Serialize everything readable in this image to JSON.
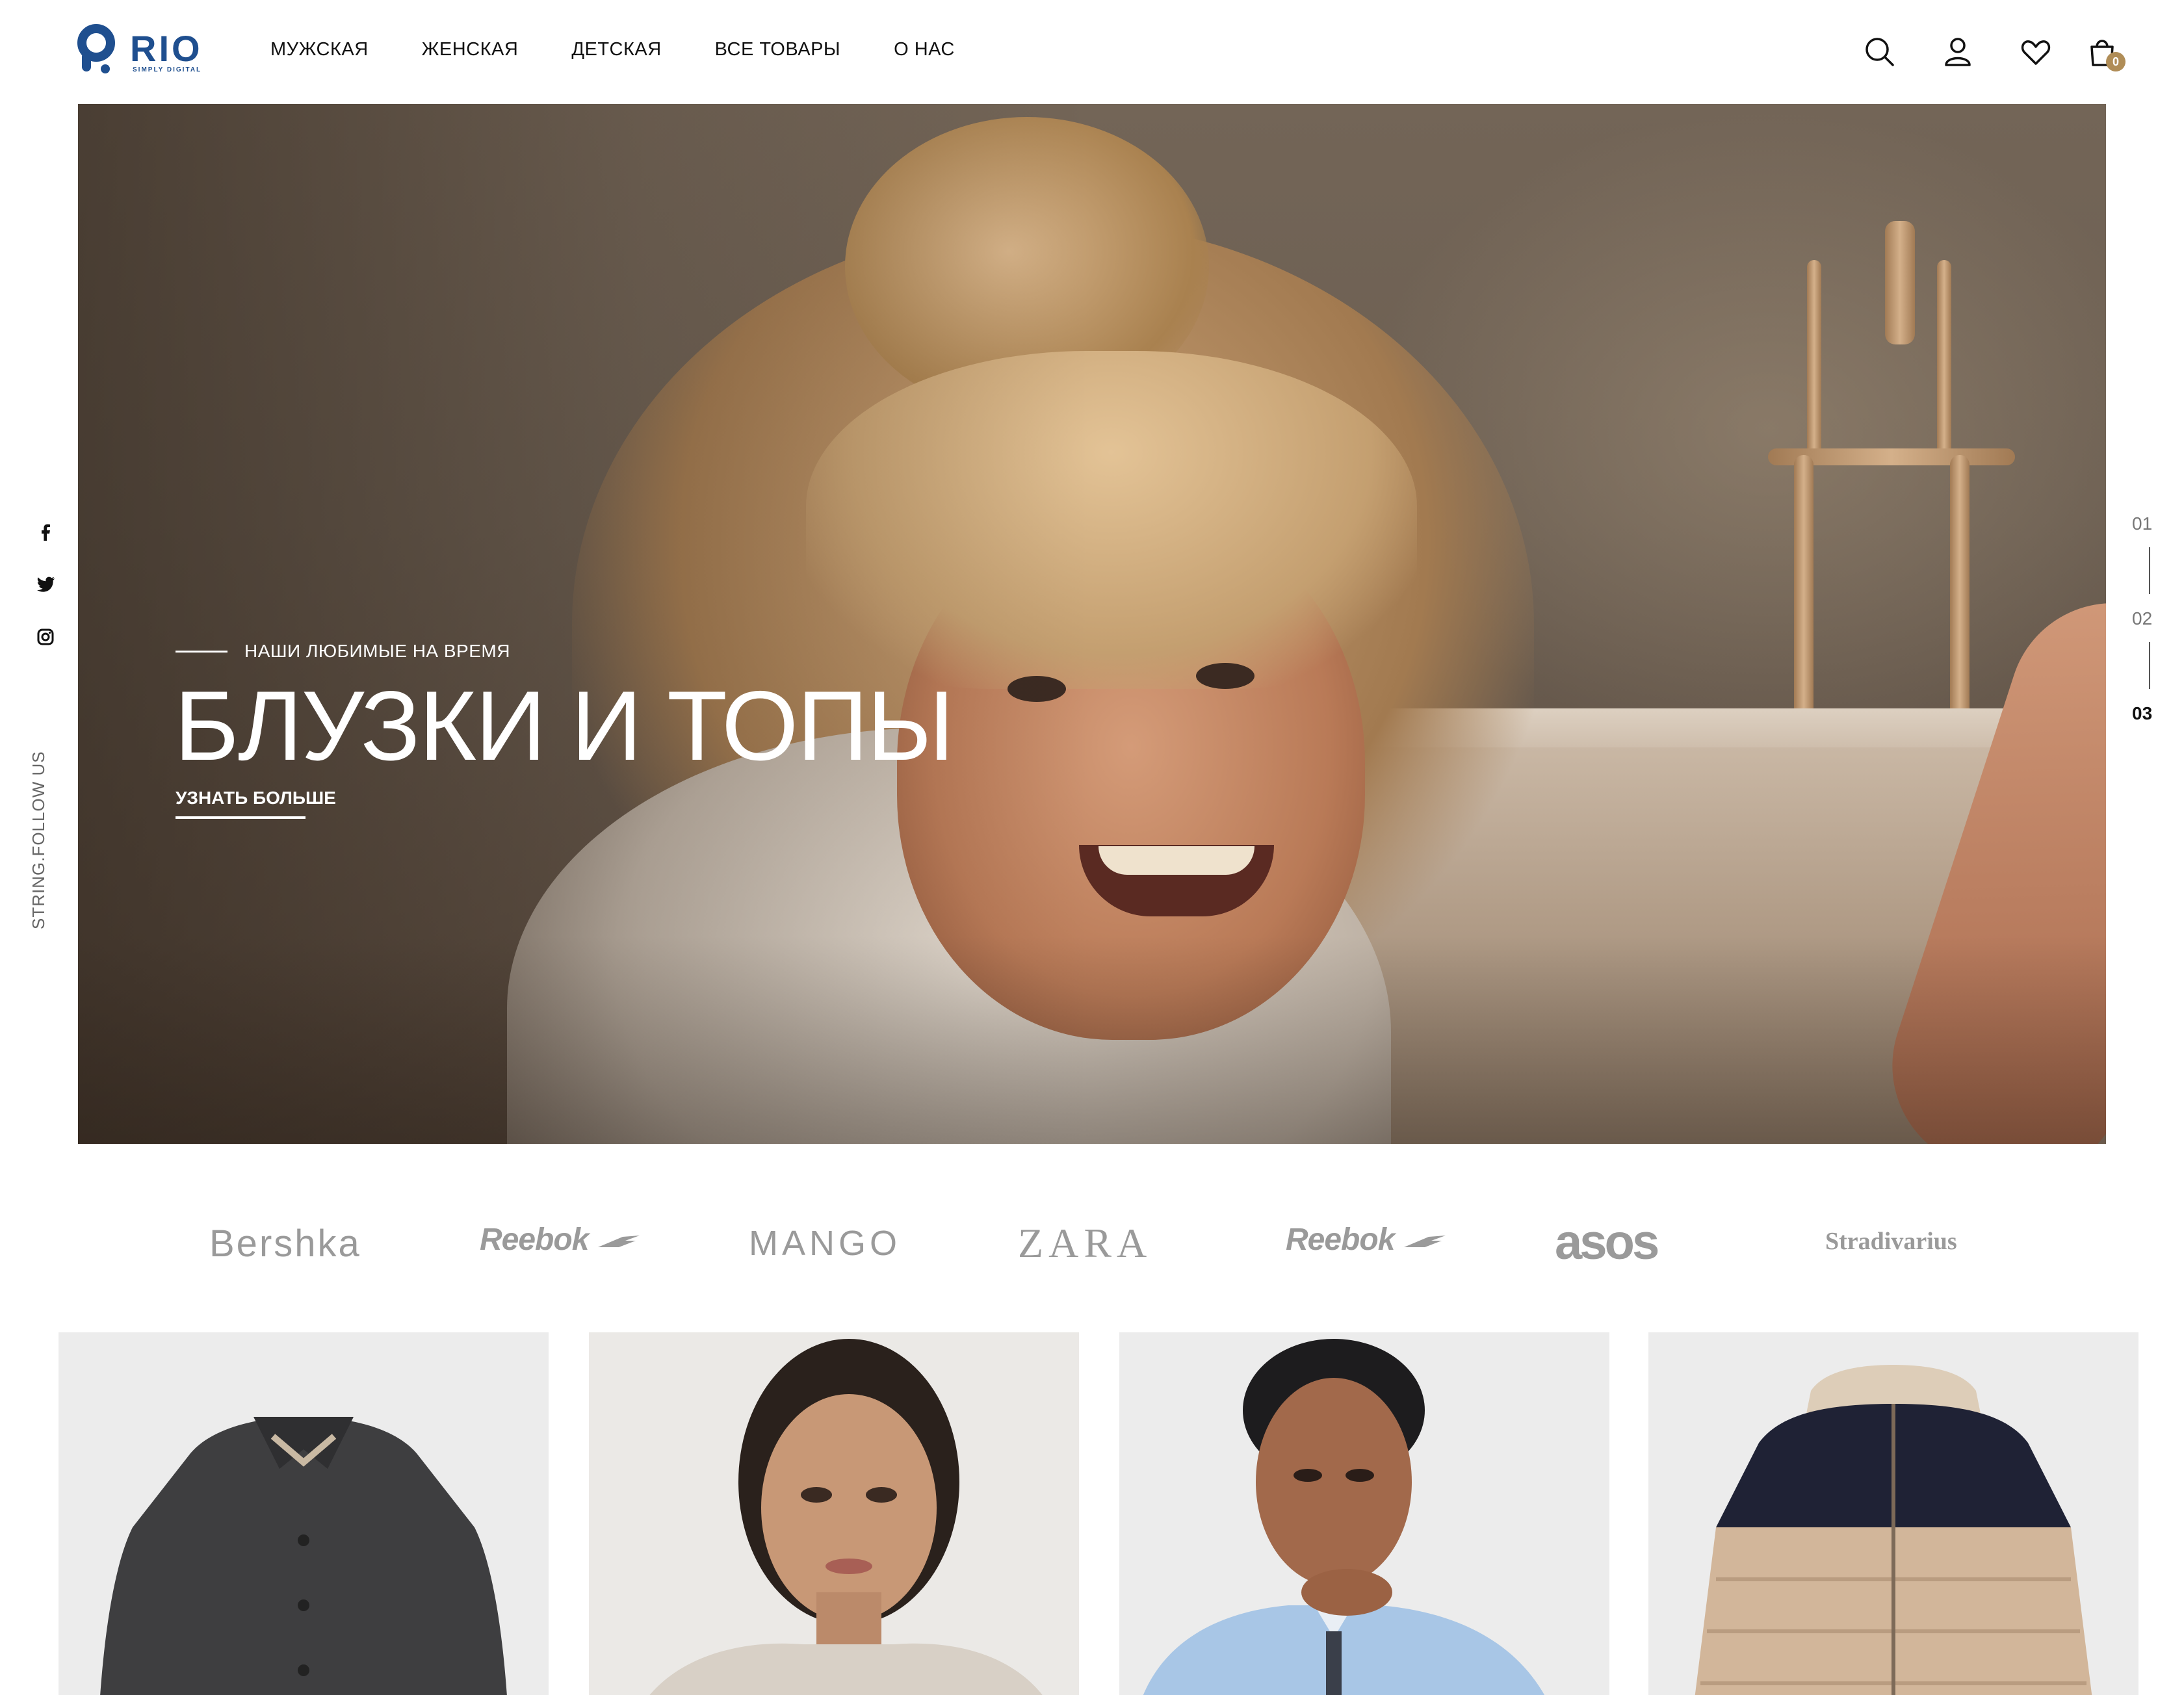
{
  "header": {
    "logo": {
      "word": "RIO",
      "tagline": "SIMPLY DIGITAL"
    },
    "nav": [
      {
        "label": "МУЖСКАЯ"
      },
      {
        "label": "ЖЕНСКАЯ"
      },
      {
        "label": "ДЕТСКАЯ"
      },
      {
        "label": "ВСЕ ТОВАРЫ"
      },
      {
        "label": "О НАС"
      }
    ],
    "icons": [
      "search-icon",
      "user-icon",
      "heart-icon",
      "bag-icon"
    ],
    "cart_count": "0"
  },
  "hero": {
    "eyebrow": "НАШИ ЛЮБИМЫЕ НА ВРЕМЯ",
    "title": "БЛУЗКИ И ТОПЫ",
    "cta": "УЗНАТЬ БОЛЬШЕ"
  },
  "social": {
    "icons": [
      "facebook-icon",
      "twitter-icon",
      "instagram-icon"
    ],
    "follow_label": "STRING.FOLLOW US"
  },
  "slider": {
    "pages": [
      "01",
      "02",
      "03"
    ],
    "active": "03"
  },
  "brands": [
    "Bershka",
    "Reebok",
    "MANGO",
    "ZARA",
    "Reebok",
    "asos",
    "Stradivarius"
  ],
  "products": [
    {
      "image": "dark teddy jacket"
    },
    {
      "image": "woman in sequin hoodie"
    },
    {
      "image": "man in blue shirt"
    },
    {
      "image": "kids puffer jacket"
    }
  ],
  "colors": {
    "brand_blue": "#1f4f8f",
    "accent_gold": "#b08d57",
    "text": "#111111",
    "muted": "#9a9a9a"
  }
}
